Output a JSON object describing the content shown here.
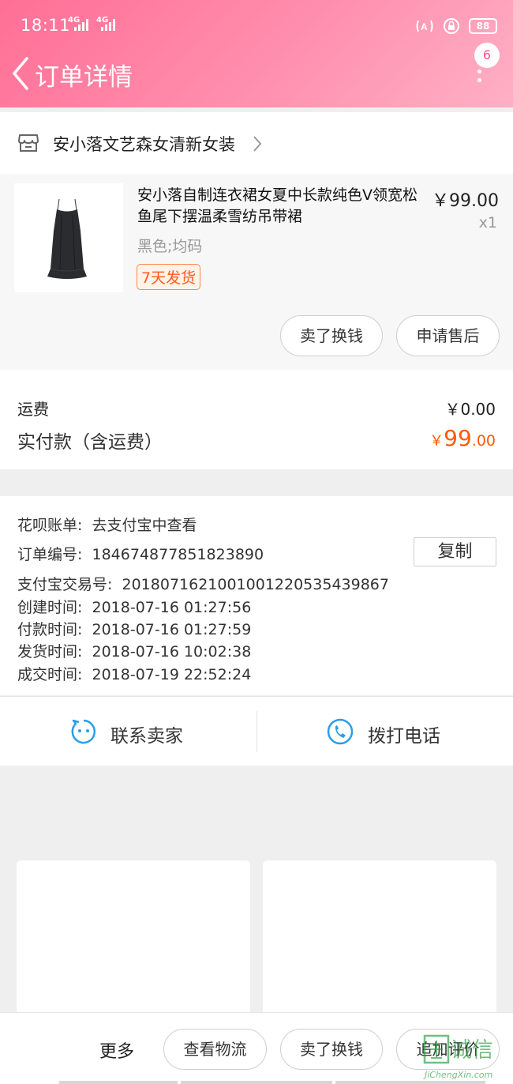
{
  "status_bar": {
    "time": "18:11",
    "network_1": "4G",
    "network_2": "4G",
    "battery": "88"
  },
  "header": {
    "title": "订单详情",
    "badge_count": "6"
  },
  "store": {
    "name": "安小落文艺森女清新女装"
  },
  "product": {
    "title": "安小落自制连衣裙女夏中长款纯色V领宽松鱼尾下摆温柔雪纺吊带裙",
    "price": "￥99.00",
    "quantity": "x1",
    "variant": "黑色;均码",
    "shipping_tag": "7天发货",
    "actions": [
      "卖了换钱",
      "申请售后"
    ]
  },
  "fees": {
    "shipping_label": "运费",
    "shipping_value": "￥0.00",
    "paid_label": "实付款（含运费）",
    "paid_currency": "￥",
    "paid_int": "99",
    "paid_dec": ".00"
  },
  "order_info": {
    "rows": [
      {
        "label": "花呗账单:",
        "value": "去支付宝中查看"
      },
      {
        "label": "订单编号:",
        "value": "184674877851823890"
      },
      {
        "label": "支付宝交易号:",
        "value": "2018071621001001220535439867"
      },
      {
        "label": "创建时间:",
        "value": "2018-07-16 01:27:56"
      },
      {
        "label": "付款时间:",
        "value": "2018-07-16 01:27:59"
      },
      {
        "label": "发货时间:",
        "value": "2018-07-16 10:02:38"
      },
      {
        "label": "成交时间:",
        "value": "2018-07-19 22:52:24"
      }
    ],
    "copy_label": "复制"
  },
  "contact": {
    "seller_label": "联系卖家",
    "phone_label": "拨打电话"
  },
  "bottom_bar": {
    "more_label": "更多",
    "logistics_label": "查看物流",
    "sell_label": "卖了换钱",
    "review_label": "追加评价"
  },
  "watermark": {
    "text": "诚信",
    "url": "JiChengXin.com"
  },
  "colors": {
    "header_gradient_start": "#ff6f95",
    "header_gradient_end": "#ffb0c6",
    "price_orange": "#ff5a00",
    "contact_blue": "#2a9ee8"
  }
}
